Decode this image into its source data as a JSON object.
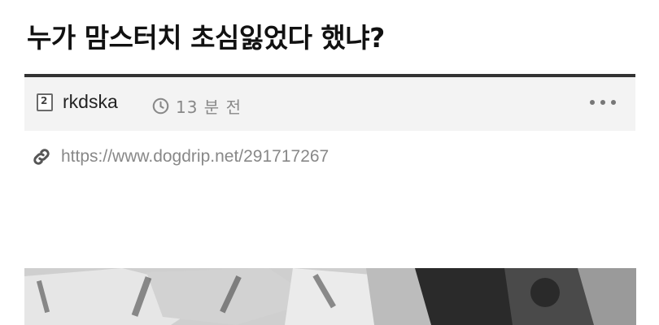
{
  "post": {
    "title": "누가 맘스터치 초심잃었다 했냐?",
    "author": "rkdska",
    "author_level": "2",
    "time_ago": "13 분 전",
    "source_url": "https://www.dogdrip.net/291717267"
  },
  "icons": {
    "avatar": "level-badge-icon",
    "time": "clock-icon",
    "more": "more-dots-icon",
    "link": "link-icon"
  },
  "colors": {
    "meta_bar_bg": "#f3f3f3",
    "meta_bar_border": "#333333",
    "muted_text": "#888888"
  }
}
